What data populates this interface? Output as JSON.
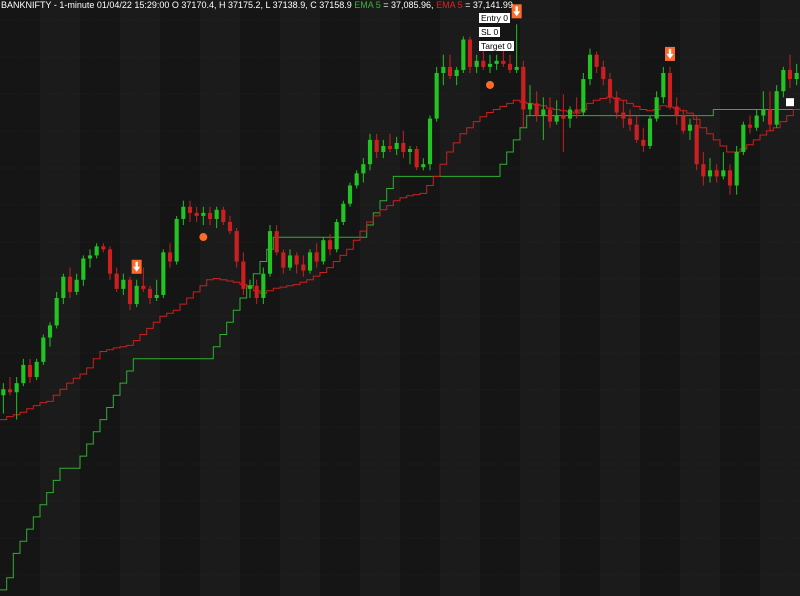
{
  "header": {
    "symbol_info": "BANKNIFTY - 1-minute 01/04/22 15:29:00 O 37170.4, H 37175.2, L 37138.9, C 37158.9",
    "ema1_label": "EMA 5",
    "ema1_value": " = 37,085.96,",
    "ema2_label": "EMA 5",
    "ema2_value": " = 37,141.99"
  },
  "tags": {
    "entry": "Entry 0",
    "sl": "SL 0",
    "target": "Target 0"
  },
  "colors": {
    "background": "#151515",
    "band": "#1b1b1b",
    "grid": "#2e2e2e",
    "up": "#22c322",
    "down": "#cc1f1f",
    "ema_fast": "#cc1f1f",
    "ema_slow": "#2fb02f",
    "marker": "#ff6a2a",
    "signal": "#ffffff"
  },
  "chart_data": {
    "type": "candlestick",
    "series_note": "",
    "ylim": [
      36310,
      37290
    ],
    "candles": [
      [
        36640,
        36660,
        36610,
        36650
      ],
      [
        36650,
        36670,
        36640,
        36645
      ],
      [
        36645,
        36670,
        36600,
        36660
      ],
      [
        36660,
        36700,
        36655,
        36690
      ],
      [
        36690,
        36700,
        36660,
        36670
      ],
      [
        36670,
        36700,
        36665,
        36695
      ],
      [
        36695,
        36740,
        36690,
        36735
      ],
      [
        36735,
        36760,
        36720,
        36755
      ],
      [
        36755,
        36810,
        36750,
        36800
      ],
      [
        36800,
        36840,
        36790,
        36835
      ],
      [
        36835,
        36850,
        36800,
        36810
      ],
      [
        36810,
        36840,
        36805,
        36830
      ],
      [
        36830,
        36870,
        36820,
        36865
      ],
      [
        36865,
        36880,
        36850,
        36870
      ],
      [
        36870,
        36890,
        36865,
        36885
      ],
      [
        36885,
        36890,
        36875,
        36880
      ],
      [
        36880,
        36885,
        36830,
        36840
      ],
      [
        36840,
        36850,
        36810,
        36815
      ],
      [
        36815,
        36840,
        36805,
        36830
      ],
      [
        36830,
        36835,
        36780,
        36790
      ],
      [
        36790,
        36830,
        36785,
        36820
      ],
      [
        36820,
        36850,
        36810,
        36815
      ],
      [
        36815,
        36820,
        36790,
        36800
      ],
      [
        36800,
        36830,
        36795,
        36805
      ],
      [
        36805,
        36880,
        36800,
        36875
      ],
      [
        36875,
        36890,
        36850,
        36860
      ],
      [
        36860,
        36935,
        36855,
        36930
      ],
      [
        36930,
        36960,
        36920,
        36950
      ],
      [
        36950,
        36960,
        36925,
        36940
      ],
      [
        36940,
        36950,
        36925,
        36935
      ],
      [
        36935,
        36950,
        36920,
        36940
      ],
      [
        36940,
        36950,
        36920,
        36930
      ],
      [
        36930,
        36950,
        36915,
        36945
      ],
      [
        36945,
        36950,
        36920,
        36925
      ],
      [
        36925,
        36935,
        36905,
        36910
      ],
      [
        36910,
        36915,
        36850,
        36860
      ],
      [
        36860,
        36875,
        36805,
        36815
      ],
      [
        36815,
        36830,
        36800,
        36820
      ],
      [
        36820,
        36830,
        36790,
        36800
      ],
      [
        36800,
        36850,
        36790,
        36840
      ],
      [
        36840,
        36920,
        36835,
        36910
      ],
      [
        36910,
        36920,
        36870,
        36875
      ],
      [
        36875,
        36880,
        36840,
        36850
      ],
      [
        36850,
        36880,
        36845,
        36870
      ],
      [
        36870,
        36875,
        36840,
        36855
      ],
      [
        36855,
        36870,
        36835,
        36845
      ],
      [
        36845,
        36880,
        36840,
        36875
      ],
      [
        36875,
        36890,
        36850,
        36860
      ],
      [
        36860,
        36900,
        36855,
        36895
      ],
      [
        36895,
        36905,
        36870,
        36880
      ],
      [
        36880,
        36930,
        36875,
        36925
      ],
      [
        36925,
        36960,
        36920,
        36955
      ],
      [
        36955,
        36990,
        36950,
        36985
      ],
      [
        36985,
        37010,
        36980,
        37005
      ],
      [
        37005,
        37030,
        36990,
        37020
      ],
      [
        37020,
        37070,
        37010,
        37060
      ],
      [
        37060,
        37070,
        37030,
        37040
      ],
      [
        37040,
        37060,
        37030,
        37050
      ],
      [
        37050,
        37070,
        37040,
        37045
      ],
      [
        37045,
        37065,
        37035,
        37055
      ],
      [
        37055,
        37075,
        37030,
        37040
      ],
      [
        37040,
        37050,
        37020,
        37045
      ],
      [
        37045,
        37050,
        37010,
        37015
      ],
      [
        37015,
        37030,
        37010,
        37020
      ],
      [
        37020,
        37100,
        37010,
        37095
      ],
      [
        37095,
        37180,
        37090,
        37170
      ],
      [
        37170,
        37200,
        37150,
        37180
      ],
      [
        37180,
        37200,
        37160,
        37165
      ],
      [
        37165,
        37180,
        37150,
        37175
      ],
      [
        37175,
        37230,
        37170,
        37225
      ],
      [
        37225,
        37230,
        37170,
        37180
      ],
      [
        37180,
        37200,
        37170,
        37190
      ],
      [
        37190,
        37210,
        37175,
        37180
      ],
      [
        37180,
        37200,
        37170,
        37185
      ],
      [
        37185,
        37200,
        37175,
        37190
      ],
      [
        37190,
        37220,
        37180,
        37185
      ],
      [
        37185,
        37200,
        37170,
        37175
      ],
      [
        37175,
        37250,
        37170,
        37180
      ],
      [
        37180,
        37190,
        37080,
        37110
      ],
      [
        37110,
        37150,
        37100,
        37120
      ],
      [
        37120,
        37140,
        37090,
        37100
      ],
      [
        37100,
        37130,
        37060,
        37110
      ],
      [
        37110,
        37130,
        37080,
        37090
      ],
      [
        37090,
        37125,
        37085,
        37100
      ],
      [
        37100,
        37135,
        37040,
        37095
      ],
      [
        37095,
        37115,
        37080,
        37110
      ],
      [
        37110,
        37130,
        37095,
        37105
      ],
      [
        37105,
        37170,
        37100,
        37160
      ],
      [
        37160,
        37210,
        37150,
        37200
      ],
      [
        37200,
        37205,
        37170,
        37180
      ],
      [
        37180,
        37190,
        37150,
        37160
      ],
      [
        37160,
        37170,
        37120,
        37130
      ],
      [
        37130,
        37140,
        37095,
        37105
      ],
      [
        37105,
        37125,
        37080,
        37095
      ],
      [
        37095,
        37110,
        37075,
        37085
      ],
      [
        37085,
        37100,
        37055,
        37060
      ],
      [
        37060,
        37080,
        37040,
        37050
      ],
      [
        37050,
        37100,
        37045,
        37095
      ],
      [
        37095,
        37140,
        37090,
        37130
      ],
      [
        37130,
        37180,
        37120,
        37170
      ],
      [
        37170,
        37180,
        37110,
        37115
      ],
      [
        37115,
        37130,
        37085,
        37100
      ],
      [
        37100,
        37110,
        37070,
        37075
      ],
      [
        37075,
        37095,
        37060,
        37085
      ],
      [
        37085,
        37100,
        37010,
        37020
      ],
      [
        37020,
        37040,
        36985,
        37000
      ],
      [
        37000,
        37030,
        36990,
        37010
      ],
      [
        37010,
        37020,
        36990,
        37000
      ],
      [
        37000,
        37040,
        36995,
        37010
      ],
      [
        37010,
        37020,
        36970,
        36985
      ],
      [
        36985,
        37050,
        36970,
        37040
      ],
      [
        37040,
        37090,
        37035,
        37085
      ],
      [
        37085,
        37100,
        37070,
        37080
      ],
      [
        37080,
        37110,
        37075,
        37100
      ],
      [
        37100,
        37140,
        37090,
        37110
      ],
      [
        37110,
        37140,
        37075,
        37085
      ],
      [
        37085,
        37150,
        37080,
        37140
      ],
      [
        37140,
        37180,
        37130,
        37175
      ],
      [
        37175,
        37200,
        37145,
        37160
      ],
      [
        37160,
        37185,
        37150,
        37170
      ]
    ],
    "ema_fast": [
      36600,
      36605,
      36608,
      36612,
      36618,
      36623,
      36628,
      36630,
      36640,
      36650,
      36660,
      36668,
      36675,
      36685,
      36700,
      36712,
      36715,
      36718,
      36720,
      36722,
      36730,
      36740,
      36750,
      36760,
      36770,
      36775,
      36780,
      36790,
      36800,
      36810,
      36820,
      36830,
      36832,
      36830,
      36828,
      36826,
      36822,
      36818,
      36812,
      36808,
      36812,
      36816,
      36818,
      36820,
      36822,
      36826,
      36830,
      36836,
      36842,
      36850,
      36860,
      36870,
      36880,
      36895,
      36910,
      36925,
      36935,
      36945,
      36952,
      36960,
      36965,
      36968,
      36970,
      36972,
      36985,
      37000,
      37020,
      37040,
      37055,
      37070,
      37080,
      37090,
      37098,
      37105,
      37110,
      37115,
      37120,
      37125,
      37122,
      37120,
      37118,
      37116,
      37112,
      37110,
      37108,
      37106,
      37104,
      37110,
      37120,
      37125,
      37128,
      37130,
      37128,
      37125,
      37120,
      37115,
      37110,
      37108,
      37110,
      37116,
      37114,
      37112,
      37108,
      37104,
      37094,
      37080,
      37070,
      37060,
      37050,
      37040,
      37040,
      37045,
      37052,
      37060,
      37068,
      37075,
      37080,
      37090,
      37100,
      37110
    ],
    "ema_slow": [
      36320,
      36340,
      36380,
      36400,
      36420,
      36440,
      36460,
      36480,
      36500,
      36520,
      36520,
      36520,
      36540,
      36560,
      36580,
      36600,
      36620,
      36640,
      36660,
      36680,
      36700,
      36700,
      36700,
      36700,
      36700,
      36700,
      36700,
      36700,
      36700,
      36700,
      36700,
      36700,
      36720,
      36740,
      36760,
      36780,
      36800,
      36820,
      36840,
      36860,
      36880,
      36900,
      36900,
      36900,
      36900,
      36900,
      36900,
      36900,
      36900,
      36900,
      36900,
      36900,
      36900,
      36900,
      36900,
      36920,
      36940,
      36960,
      36980,
      37000,
      37000,
      37000,
      37000,
      37000,
      37000,
      37000,
      37000,
      37000,
      37000,
      37000,
      37000,
      37000,
      37000,
      37000,
      37000,
      37020,
      37040,
      37060,
      37080,
      37100,
      37100,
      37100,
      37100,
      37100,
      37100,
      37100,
      37100,
      37100,
      37100,
      37100,
      37100,
      37100,
      37100,
      37100,
      37100,
      37100,
      37100,
      37100,
      37100,
      37100,
      37100,
      37100,
      37100,
      37100,
      37100,
      37100,
      37100,
      37110,
      37110,
      37110,
      37110,
      37110,
      37110,
      37110,
      37110,
      37110,
      37110,
      37110,
      37110,
      37110
    ],
    "sell_signals": [
      20,
      77,
      100
    ],
    "dot_markers": [
      30,
      73
    ],
    "square_markers": [
      118
    ]
  }
}
